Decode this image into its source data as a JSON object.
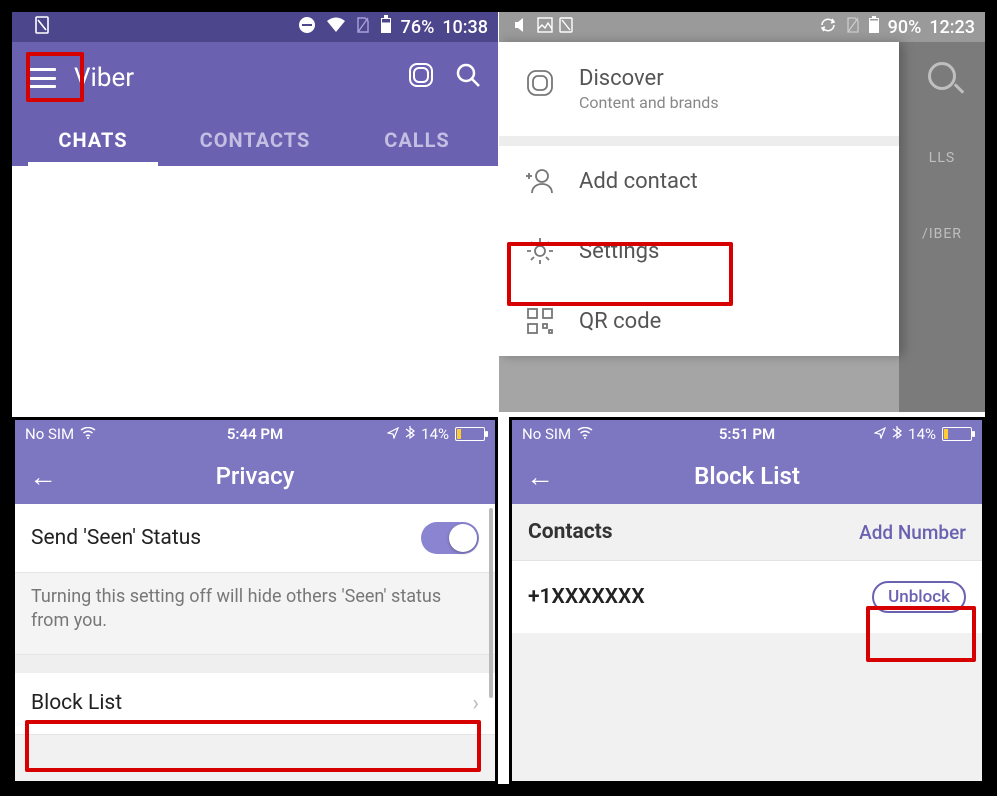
{
  "panel1": {
    "status": {
      "battery": "76%",
      "time": "10:38"
    },
    "app_title": "Viber",
    "tabs": {
      "chats": "CHATS",
      "contacts": "CONTACTS",
      "calls": "CALLS"
    }
  },
  "panel2": {
    "status": {
      "battery": "90%",
      "time": "12:23"
    },
    "menu": {
      "discover": {
        "label": "Discover",
        "sub": "Content and brands"
      },
      "add_contact": "Add contact",
      "settings": "Settings",
      "qr": "QR code"
    },
    "bg": {
      "tab_stub": "LLS",
      "label_stub": "/IBER"
    }
  },
  "panel3": {
    "status": {
      "carrier": "No SIM",
      "time": "5:44 PM",
      "battery": "14%"
    },
    "header_title": "Privacy",
    "seen_label": "Send 'Seen' Status",
    "seen_desc": "Turning this setting off will hide others 'Seen' status from you.",
    "block_list": "Block List"
  },
  "panel4": {
    "status": {
      "carrier": "No SIM",
      "time": "5:51 PM",
      "battery": "14%"
    },
    "header_title": "Block List",
    "section_label": "Contacts",
    "add_number": "Add Number",
    "blocked_number": "+1XXXXXXX",
    "unblock": "Unblock"
  }
}
